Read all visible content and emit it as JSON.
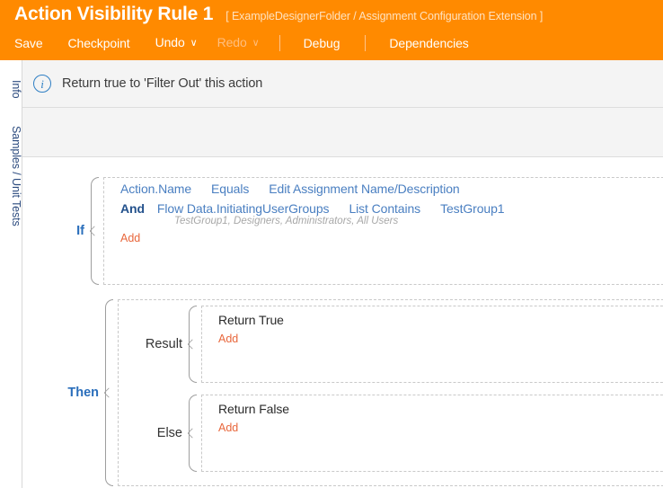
{
  "header": {
    "title": "Action Visibility Rule 1",
    "subtitle": "[ ExampleDesignerFolder / Assignment Configuration Extension ]",
    "accent_color": "#FF8A00",
    "toolbar": {
      "save": "Save",
      "checkpoint": "Checkpoint",
      "undo": "Undo",
      "undo_caret": "∨",
      "redo": "Redo",
      "redo_caret": "∨",
      "debug": "Debug",
      "dependencies": "Dependencies"
    }
  },
  "rail": {
    "tabs": [
      {
        "label": "Info"
      },
      {
        "label": "Samples / Unit Tests"
      }
    ]
  },
  "info_banner": {
    "icon": "info-circle-icon",
    "icon_glyph": "i",
    "text": "Return true to 'Filter Out' this action",
    "icon_color": "#2f7fc4"
  },
  "rule": {
    "if": {
      "label": "If",
      "label_color": "#2a6ebb",
      "conditions": [
        {
          "operator": "",
          "subject": "Action.Name",
          "comparator": "Equals",
          "value": "Edit Assignment Name/Description",
          "note": ""
        },
        {
          "operator": "And",
          "subject": "Flow Data.InitiatingUserGroups",
          "comparator": "List Contains",
          "value": "TestGroup1",
          "note": "TestGroup1, Designers, Administrators, All Users"
        }
      ],
      "add_label": "Add"
    },
    "then": {
      "label": "Then",
      "label_color": "#2a6ebb",
      "branches": [
        {
          "label": "Result",
          "action": "Return True",
          "add_label": "Add"
        },
        {
          "label": "Else",
          "action": "Return False",
          "add_label": "Add"
        }
      ]
    }
  }
}
